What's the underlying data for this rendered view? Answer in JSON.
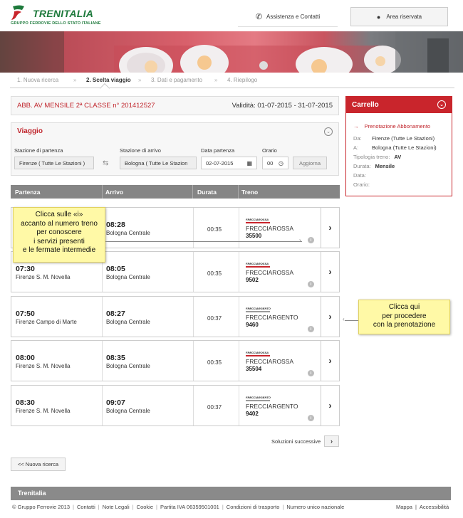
{
  "header": {
    "logo_text": "TRENITALIA",
    "logo_sub": "GRUPPO FERROVIE DELLO STATO ITALIANE",
    "assistenza": "Assistenza e Contatti",
    "area_riservata": "Area riservata",
    "colors": {
      "brand_green": "#1e7a3c",
      "accent_red": "#c9252c"
    }
  },
  "steps": [
    {
      "label": "1. Nuova ricerca",
      "active": false
    },
    {
      "label": "2. Scelta viaggio",
      "active": true
    },
    {
      "label": "3. Dati e pagamento",
      "active": false
    },
    {
      "label": "4. Riepilogo",
      "active": false
    }
  ],
  "step_separator": "»",
  "abbonamento": {
    "title": "ABB. AV MENSILE 2ª CLASSE n° 201412527",
    "validita": "Validità: 01-07-2015 - 31-07-2015"
  },
  "viaggio": {
    "title": "Viaggio",
    "partenza_label": "Stazione di partenza",
    "partenza_value": "Firenze ( Tutte Le Stazioni )",
    "arrivo_label": "Stazione di arrivo",
    "arrivo_value": "Bologna ( Tutte Le Stazion",
    "data_label": "Data partenza",
    "data_value": "02-07-2015",
    "orario_label": "Orario",
    "orario_value": "00",
    "aggiorna": "Aggiorna"
  },
  "table": {
    "headers": [
      "Partenza",
      "Arrivo",
      "Durata",
      "Treno"
    ],
    "rows": [
      {
        "dep_time": "",
        "dep_station": "",
        "arr_time": "08:28",
        "arr_station": "Bologna Centrale",
        "duration": "00:35",
        "brand": "FRECCIAROSSA",
        "brand_logo": "FRECCIAROSSA",
        "number": "35500"
      },
      {
        "dep_time": "07:30",
        "dep_station": "Firenze S. M. Novella",
        "arr_time": "08:05",
        "arr_station": "Bologna Centrale",
        "duration": "00:35",
        "brand": "FRECCIAROSSA",
        "brand_logo": "FRECCIAROSSA",
        "number": "9502"
      },
      {
        "dep_time": "07:50",
        "dep_station": "Firenze Campo di Marte",
        "arr_time": "08:27",
        "arr_station": "Bologna Centrale",
        "duration": "00:37",
        "brand": "FRECCIARGENTO",
        "brand_logo": "FRECCIARGENTO",
        "number": "9460"
      },
      {
        "dep_time": "08:00",
        "dep_station": "Firenze S. M. Novella",
        "arr_time": "08:35",
        "arr_station": "Bologna Centrale",
        "duration": "00:35",
        "brand": "FRECCIAROSSA",
        "brand_logo": "FRECCIAROSSA",
        "number": "35504"
      },
      {
        "dep_time": "08:30",
        "dep_station": "Firenze S. M. Novella",
        "arr_time": "09:07",
        "arr_station": "Bologna Centrale",
        "duration": "00:37",
        "brand": "FRECCIARGENTO",
        "brand_logo": "FRECCIARGENTO",
        "number": "9402"
      }
    ]
  },
  "tips": {
    "left": [
      "Clicca sulle «i»",
      "accanto al numero treno",
      "per conoscere",
      "i servizi presenti",
      "e le fermate intermedie"
    ],
    "right": [
      "Clicca qui",
      "per procedere",
      "con la prenotazione"
    ]
  },
  "carrello": {
    "title": "Carrello",
    "sub": "Prenotazione Abbonamento",
    "rows": [
      {
        "label": "Da:",
        "value": "Firenze (Tutte Le Stazioni)"
      },
      {
        "label": "A:",
        "value": "Bologna (Tutte Le Stazioni)"
      },
      {
        "label": "Tipologia treno:",
        "value": "AV"
      },
      {
        "label": "Durata:",
        "value": "Mensile"
      },
      {
        "label": "Data:",
        "value": ""
      },
      {
        "label": "Orario:",
        "value": ""
      }
    ]
  },
  "soluzioni_successive": "Soluzioni successive",
  "nuova_ricerca": "<< Nuova ricerca",
  "footer": {
    "title": "Trenitalia",
    "links": [
      "© Gruppo Ferrovie 2013",
      "Contatti",
      "Note Legali",
      "Cookie",
      "Partita IVA 06359501001",
      "Condizioni di trasporto",
      "Numero unico nazionale"
    ],
    "right_links": [
      "Mappa",
      "Accessibilità"
    ]
  }
}
